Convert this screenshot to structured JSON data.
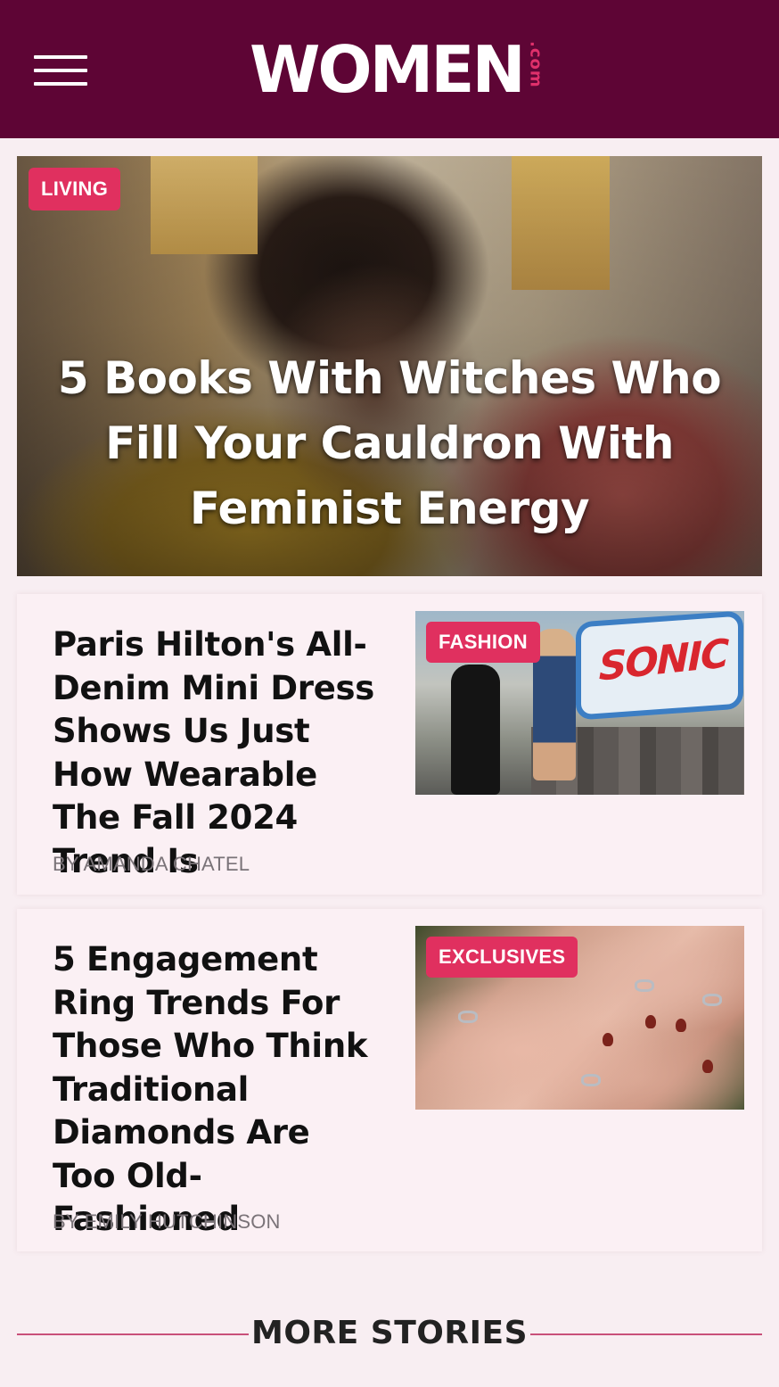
{
  "header": {
    "logo_main": "WOMEN",
    "logo_suffix": ".com",
    "menu_icon": "hamburger-menu-icon",
    "background_color": "#5e0535"
  },
  "hero": {
    "category": "LIVING",
    "title": "5 Books With Witches Who Fill Your Cauldron With Feminist Energy"
  },
  "articles": [
    {
      "category": "FASHION",
      "title": "Paris Hilton's All-Denim Mini Dress Shows Us Just How Wearable The Fall 2024 Trend Is",
      "author": "BY AMANDA CHATEL",
      "thumb_sign_text": "SONIC"
    },
    {
      "category": "EXCLUSIVES",
      "title": "5 Engagement Ring Trends For Those Who Think Traditional Diamonds Are Too Old-Fashioned",
      "author": "BY EMILY HUTCHINSON"
    }
  ],
  "more_stories": {
    "label": "MORE STORIES"
  },
  "colors": {
    "accent": "#e0305f",
    "divider": "#c9507a",
    "card_bg": "#fbf0f4",
    "page_bg": "#f8eef2"
  }
}
